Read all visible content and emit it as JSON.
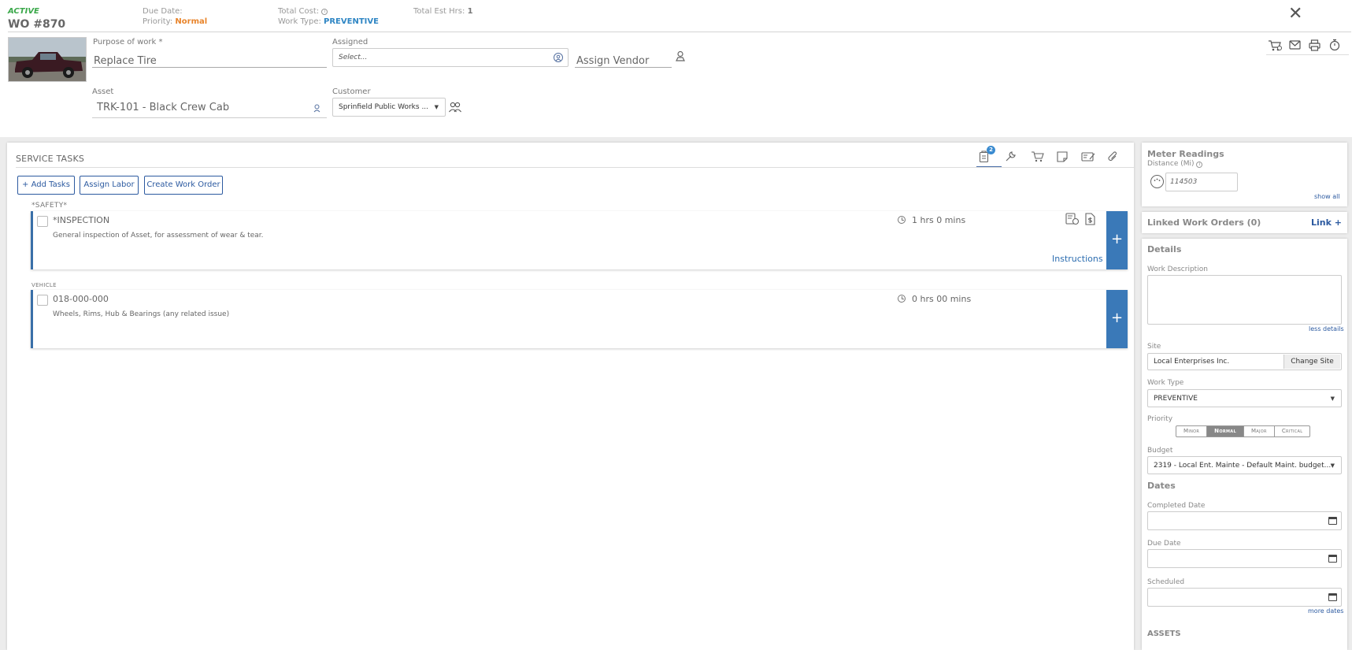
{
  "header": {
    "status": "ACTIVE",
    "status_color": "#3aa84a",
    "wo_number": "WO #870",
    "due_date_label": "Due Date:",
    "priority_label": "Priority:",
    "priority_value": "Normal",
    "priority_color": "#e8842b",
    "total_cost_label": "Total Cost:",
    "work_type_label": "Work Type:",
    "work_type_value": "PREVENTIVE",
    "work_type_color": "#2f86c4",
    "total_est_label": "Total Est Hrs:",
    "total_est_value": "1"
  },
  "form": {
    "purpose_label": "Purpose of work *",
    "purpose_value": "Replace Tire",
    "assigned_label": "Assigned",
    "assigned_placeholder": "Select...",
    "vendor_value": "Assign Vendor",
    "asset_label": "Asset",
    "asset_value": "TRK-101 - Black Crew Cab",
    "customer_label": "Customer",
    "customer_value": "Sprinfield Public Works ..."
  },
  "tasks": {
    "title": "SERVICE TASKS",
    "badge": "2",
    "add_tasks": "+ Add Tasks",
    "assign_labor": "Assign Labor",
    "create_wo": "Create Work Order",
    "groups": [
      {
        "label": "*SAFETY*",
        "name": "*INSPECTION",
        "desc": "General inspection of Asset, for assessment of wear & tear.",
        "time": "1 hrs 0 mins",
        "instructions": "Instructions"
      },
      {
        "label": "VEHICLE",
        "name": "018-000-000",
        "desc": "Wheels, Rims, Hub & Bearings (any related issue)",
        "time": "0 hrs 00 mins"
      }
    ]
  },
  "meter": {
    "title": "Meter Readings",
    "distance_label": "Distance (Mi)",
    "distance_value": "114503",
    "show_all": "show all"
  },
  "linked": {
    "title": "Linked Work Orders (0)",
    "link": "Link +"
  },
  "details": {
    "title": "Details",
    "work_desc_label": "Work Description",
    "less_details": "less details",
    "site_label": "Site",
    "site_value": "Local Enterprises Inc.",
    "change_site": "Change Site",
    "work_type_label": "Work Type",
    "work_type_value": "PREVENTIVE",
    "priority_label": "Priority",
    "priority_options": [
      "Minor",
      "Normal",
      "Major",
      "Critical"
    ],
    "budget_label": "Budget",
    "budget_value": "2319 - Local Ent. Mainte - Default Maint. budget...",
    "dates_title": "Dates",
    "completed_label": "Completed Date",
    "due_label": "Due Date",
    "scheduled_label": "Scheduled",
    "more_dates": "more dates",
    "assets_title": "ASSETS"
  }
}
